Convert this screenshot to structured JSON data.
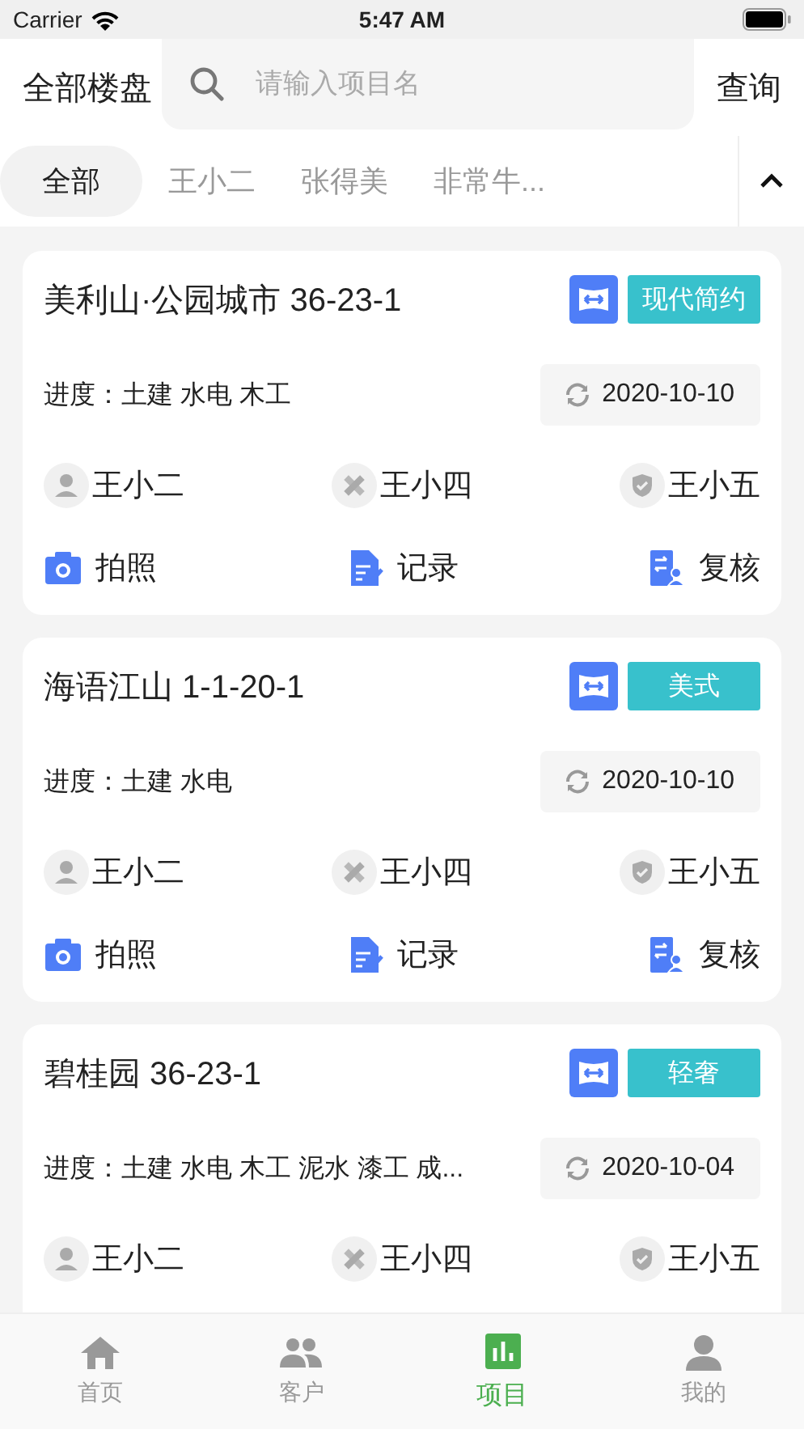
{
  "status_bar": {
    "carrier": "Carrier",
    "time": "5:47 AM"
  },
  "header": {
    "scope": "全部楼盘",
    "search": {
      "placeholder": "请输入项目名"
    },
    "query_button": "查询"
  },
  "filters": [
    {
      "label": "全部",
      "selected": true
    },
    {
      "label": "王小二",
      "selected": false
    },
    {
      "label": "张得美",
      "selected": false
    },
    {
      "label": "非常牛...",
      "selected": false
    }
  ],
  "projects": [
    {
      "title": "美利山·公园城市 36-23-1",
      "style_tag": "现代简约",
      "progress": "进度：土建 水电 木工",
      "date": "2020-10-10",
      "people": [
        "王小二",
        "王小四",
        "王小五"
      ],
      "actions": [
        "拍照",
        "记录",
        "复核"
      ]
    },
    {
      "title": "海语江山 1-1-20-1",
      "style_tag": "美式",
      "progress": "进度：土建 水电",
      "date": "2020-10-10",
      "people": [
        "王小二",
        "王小四",
        "王小五"
      ],
      "actions": [
        "拍照",
        "记录",
        "复核"
      ]
    },
    {
      "title": "碧桂园 36-23-1",
      "style_tag": "轻奢",
      "progress": "进度：土建 水电 木工 泥水 漆工 成...",
      "date": "2020-10-04",
      "people": [
        "王小二",
        "王小四",
        "王小五"
      ]
    }
  ],
  "tab_bar": [
    {
      "label": "首页",
      "selected": false
    },
    {
      "label": "客户",
      "selected": false
    },
    {
      "label": "项目",
      "selected": true
    },
    {
      "label": "我的",
      "selected": false
    }
  ]
}
